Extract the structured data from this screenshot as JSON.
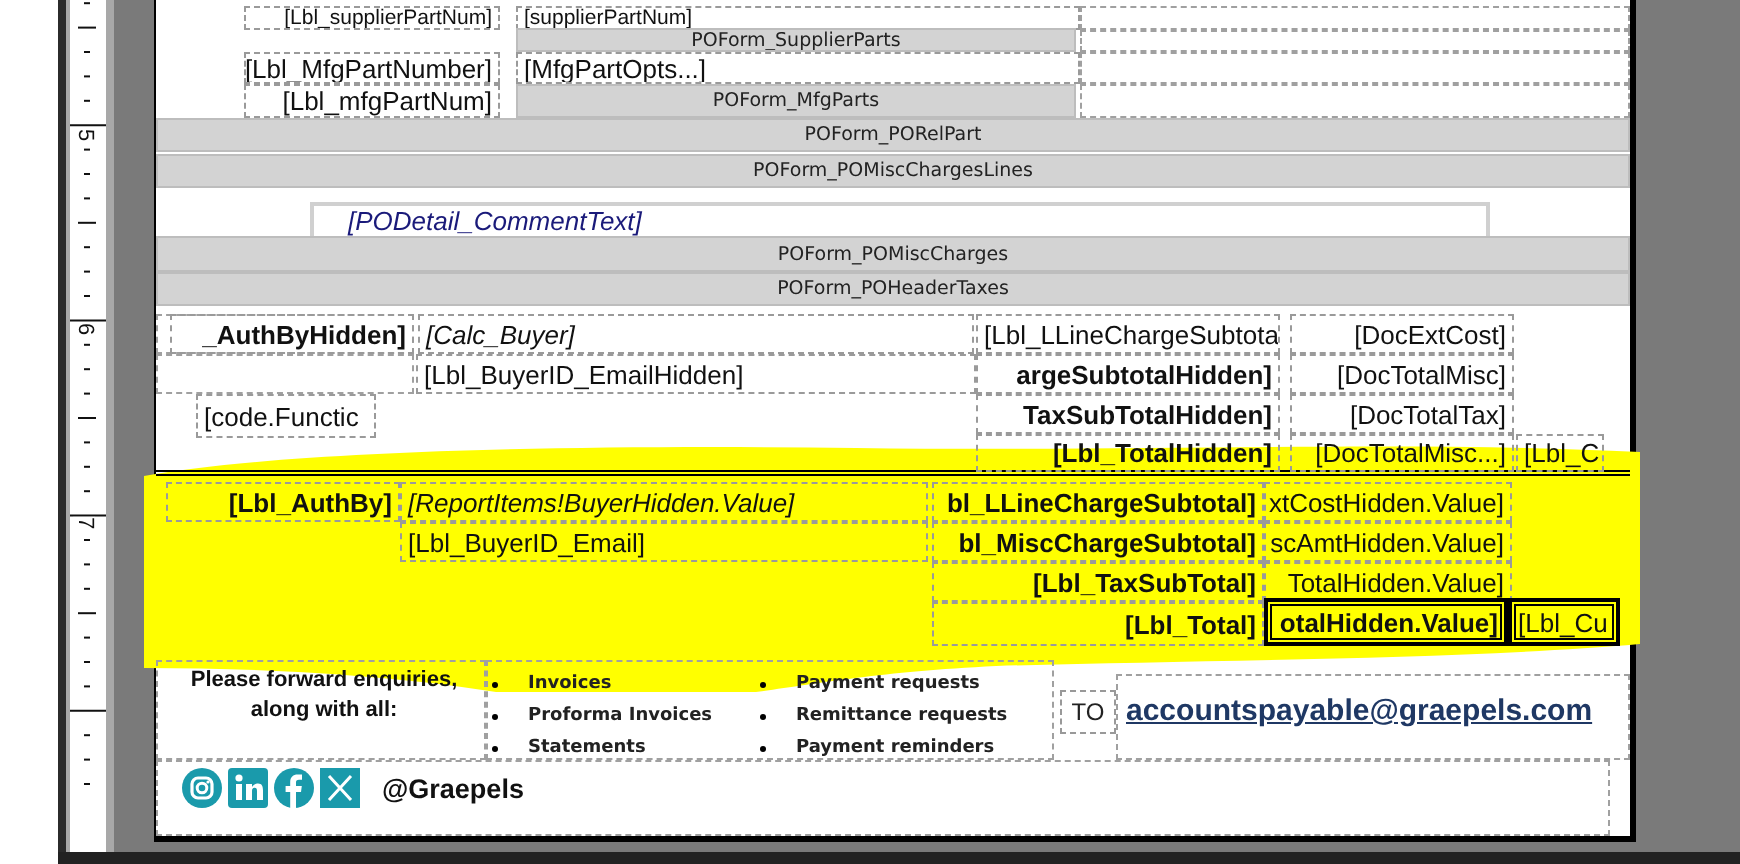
{
  "ruler": {
    "labels": [
      "5",
      "6",
      "7"
    ]
  },
  "report_items": [
    {
      "text": "[Lbl_supplierPartNum]",
      "kind": "caption",
      "selected": false
    },
    {
      "text": "[supplierPartNum]",
      "kind": "field",
      "selected": false
    },
    {
      "text": "POForm_SupplierParts",
      "kind": "band",
      "selected": false
    },
    {
      "text": "[Lbl_MfgPartNumber]",
      "kind": "caption",
      "selected": false
    },
    {
      "text": "[MfgPartOpts...]",
      "kind": "field",
      "selected": false
    },
    {
      "text": "[Lbl_mfgPartNum]",
      "kind": "caption",
      "selected": false
    },
    {
      "text": "POForm_MfgParts",
      "kind": "band",
      "selected": false
    },
    {
      "text": "POForm_PORelPart",
      "kind": "band",
      "selected": false
    },
    {
      "text": "POForm_POMiscChargesLines",
      "kind": "band",
      "selected": false
    },
    {
      "text": "[PODetail_CommentText]",
      "kind": "comment",
      "selected": false
    },
    {
      "text": "POForm_POMiscCharges",
      "kind": "band",
      "selected": false
    },
    {
      "text": "POForm_POHeaderTaxes",
      "kind": "band",
      "selected": false
    },
    {
      "text": "_AuthByHidden]",
      "kind": "heading",
      "selected": false
    },
    {
      "text": "[Calc_Buyer]",
      "kind": "expression",
      "selected": false
    },
    {
      "text": "[Lbl_LLineChargeSubtota",
      "kind": "field",
      "selected": false
    },
    {
      "text": "[DocExtCost]",
      "kind": "caption",
      "selected": false
    },
    {
      "text": "[Lbl_BuyerID_EmailHidden]",
      "kind": "field",
      "selected": false
    },
    {
      "text": "argeSubtotalHidden]",
      "kind": "heading",
      "selected": false
    },
    {
      "text": "[DocTotalMisc]",
      "kind": "caption",
      "selected": false
    },
    {
      "text": "[code.Functic",
      "kind": "field",
      "selected": false
    },
    {
      "text": "TaxSubTotalHidden]",
      "kind": "heading",
      "selected": false
    },
    {
      "text": "[DocTotalTax]",
      "kind": "caption",
      "selected": false
    },
    {
      "text": "[Lbl_TotalHidden]",
      "kind": "heading",
      "selected": false
    },
    {
      "text": "[DocTotalMisc...]",
      "kind": "caption",
      "selected": false
    },
    {
      "text": "[Lbl_C",
      "kind": "field",
      "selected": false
    },
    {
      "text": "[Lbl_AuthBy]",
      "kind": "heading",
      "selected": false
    },
    {
      "text": "[ReportItems!BuyerHidden.Value]",
      "kind": "expression",
      "selected": false
    },
    {
      "text": "[Lbl_BuyerID_Email]",
      "kind": "field",
      "selected": false
    },
    {
      "text": "bl_LLineChargeSubtotal]",
      "kind": "heading",
      "selected": false
    },
    {
      "text": "xtCostHidden.Value]",
      "kind": "caption",
      "selected": false
    },
    {
      "text": "bl_MiscChargeSubtotal]",
      "kind": "heading",
      "selected": false
    },
    {
      "text": "scAmtHidden.Value]",
      "kind": "caption",
      "selected": false
    },
    {
      "text": "[Lbl_TaxSubTotal]",
      "kind": "heading",
      "selected": false
    },
    {
      "text": "TotalHidden.Value]",
      "kind": "caption",
      "selected": false
    },
    {
      "text": "[Lbl_Total]",
      "kind": "heading",
      "selected": false
    },
    {
      "text": "otalHidden.Value]",
      "kind": "heading",
      "selected": true
    },
    {
      "text": "[Lbl_Cu",
      "kind": "field",
      "selected": true
    }
  ],
  "footer": {
    "intro": "Please forward enquiries, along with all:",
    "list_1": [
      "Invoices",
      "Proforma Invoices",
      "Statements"
    ],
    "list_2": [
      "Payment requests",
      "Remittance requests",
      "Payment reminders"
    ],
    "to_label": "TO",
    "email": "accountspayable@graepels.com",
    "social_handle": "@Graepels"
  }
}
